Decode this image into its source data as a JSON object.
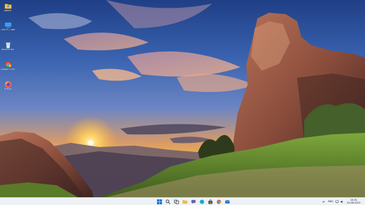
{
  "desktop": {
    "icons": [
      {
        "label": "Admin",
        "icon": "user-folder-icon"
      },
      {
        "label": "This PC / Networking",
        "icon": "monitor-icon"
      },
      {
        "label": "Recycle Bin",
        "icon": "recycle-bin-icon"
      },
      {
        "label": "Google Chrome",
        "icon": "chrome-icon"
      },
      {
        "label": "Firefox",
        "icon": "firefox-icon"
      }
    ]
  },
  "taskbar": {
    "apps": [
      {
        "name": "start",
        "icon": "windows-start-icon"
      },
      {
        "name": "search",
        "icon": "search-icon"
      },
      {
        "name": "task-view",
        "icon": "task-view-icon"
      },
      {
        "name": "file-explorer",
        "icon": "folder-icon"
      },
      {
        "name": "chat",
        "icon": "chat-icon"
      },
      {
        "name": "edge",
        "icon": "edge-icon"
      },
      {
        "name": "store",
        "icon": "store-icon"
      },
      {
        "name": "chrome",
        "icon": "chrome-icon"
      },
      {
        "name": "mail",
        "icon": "mail-icon"
      }
    ],
    "tray": {
      "language": "ENG",
      "time": "14:51",
      "date": "24.08.2022"
    }
  }
}
